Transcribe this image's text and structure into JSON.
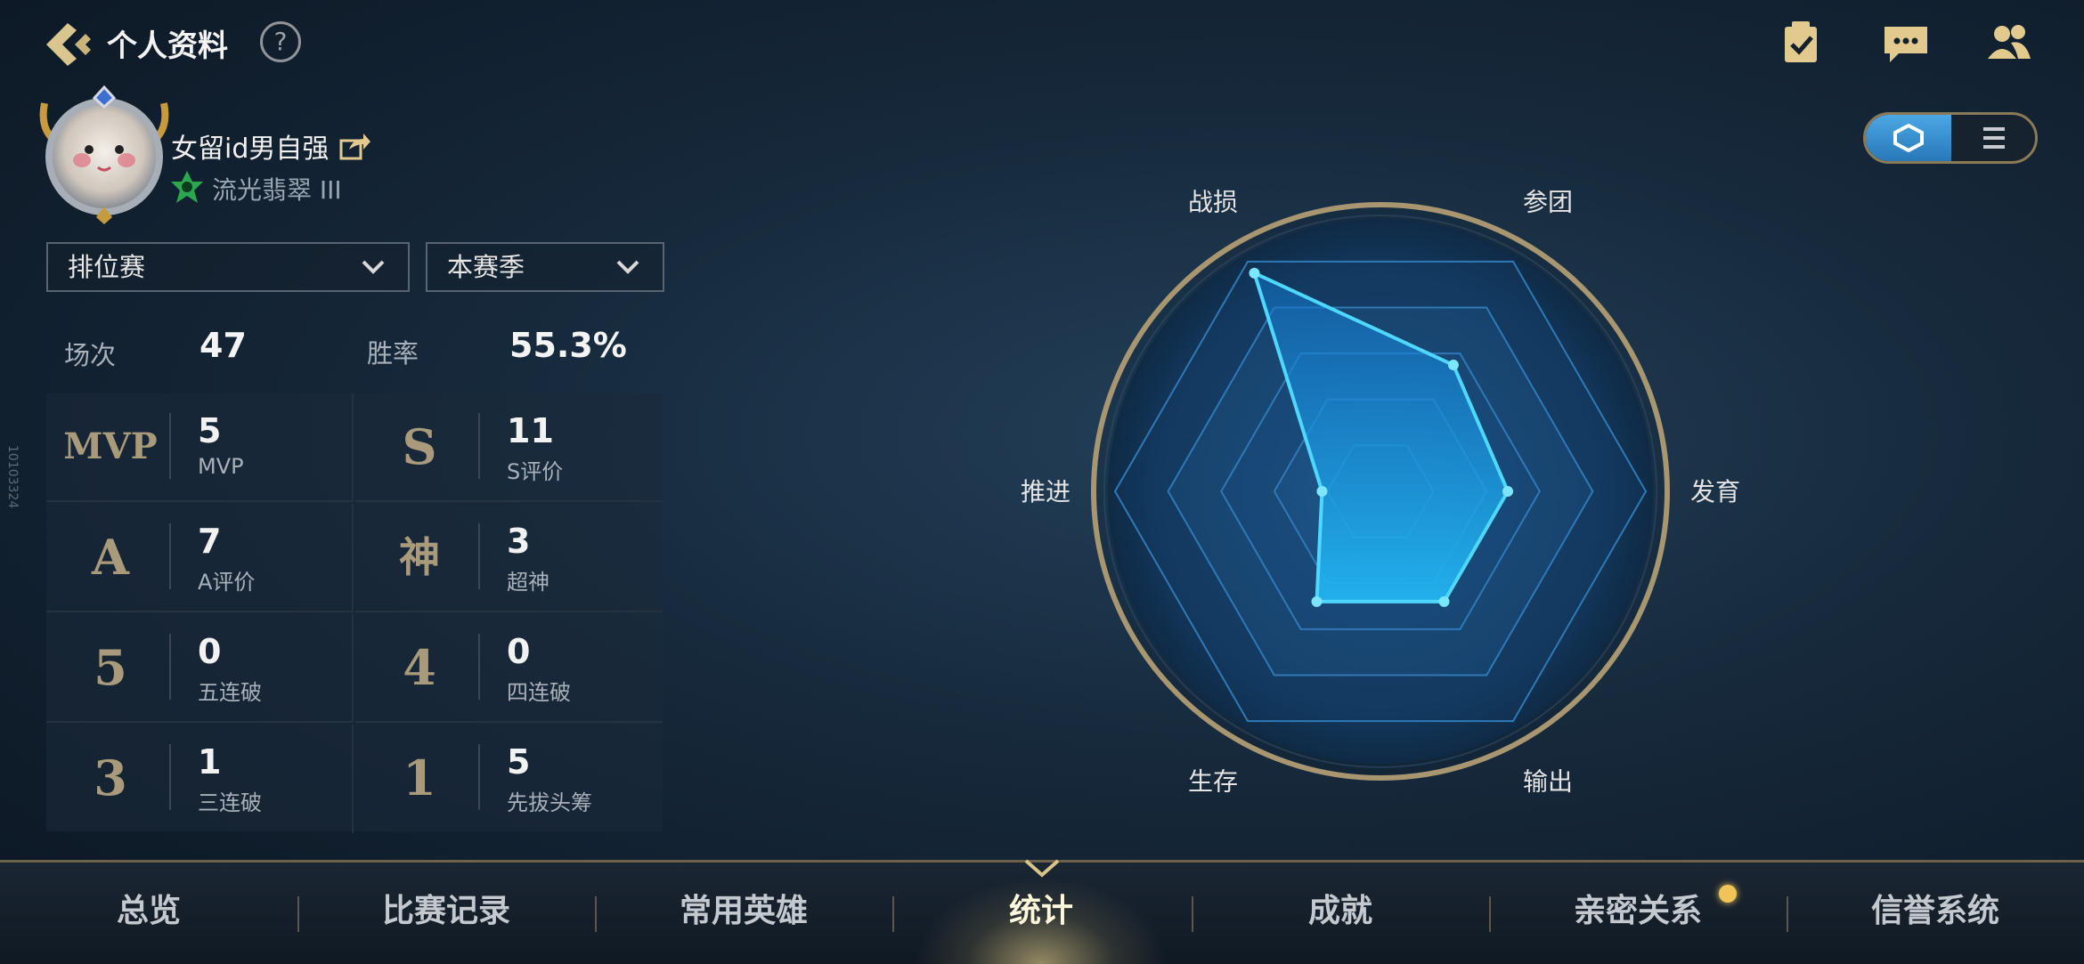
{
  "header": {
    "title": "个人资料",
    "help_label": "?"
  },
  "profile": {
    "name": "女留id男自强",
    "rank": "流光翡翠 III"
  },
  "filters": {
    "mode": "排位赛",
    "season": "本赛季"
  },
  "summary": {
    "games_label": "场次",
    "games_value": "47",
    "winrate_label": "胜率",
    "winrate_value": "55.3%"
  },
  "stats": [
    {
      "badge": "MVP",
      "value": "5",
      "label": "MVP"
    },
    {
      "badge": "S",
      "value": "11",
      "label": "S评价"
    },
    {
      "badge": "A",
      "value": "7",
      "label": "A评价"
    },
    {
      "badge": "神",
      "value": "3",
      "label": "超神"
    },
    {
      "badge": "5",
      "value": "0",
      "label": "五连破"
    },
    {
      "badge": "4",
      "value": "0",
      "label": "四连破"
    },
    {
      "badge": "3",
      "value": "1",
      "label": "三连破"
    },
    {
      "badge": "1",
      "value": "5",
      "label": "先拔头筹"
    }
  ],
  "radar": {
    "labels": [
      "战损",
      "参团",
      "发育",
      "输出",
      "生存",
      "推进"
    ],
    "values": [
      0.95,
      0.55,
      0.48,
      0.48,
      0.48,
      0.22
    ],
    "fill_color": "#1fa0e8",
    "stroke_color": "#4fd8ff"
  },
  "side_id": "10103324",
  "nav": {
    "tabs": [
      "总览",
      "比赛记录",
      "常用英雄",
      "统计",
      "成就",
      "亲密关系",
      "信誉系统"
    ],
    "active": "统计"
  },
  "icons": {
    "back": "back-arrow-icon",
    "help": "help-icon",
    "task": "checklist-icon",
    "chat": "chat-icon",
    "friends": "friends-icon",
    "share": "share-icon",
    "radar_view": "hexagon-icon",
    "list_view": "list-icon"
  }
}
